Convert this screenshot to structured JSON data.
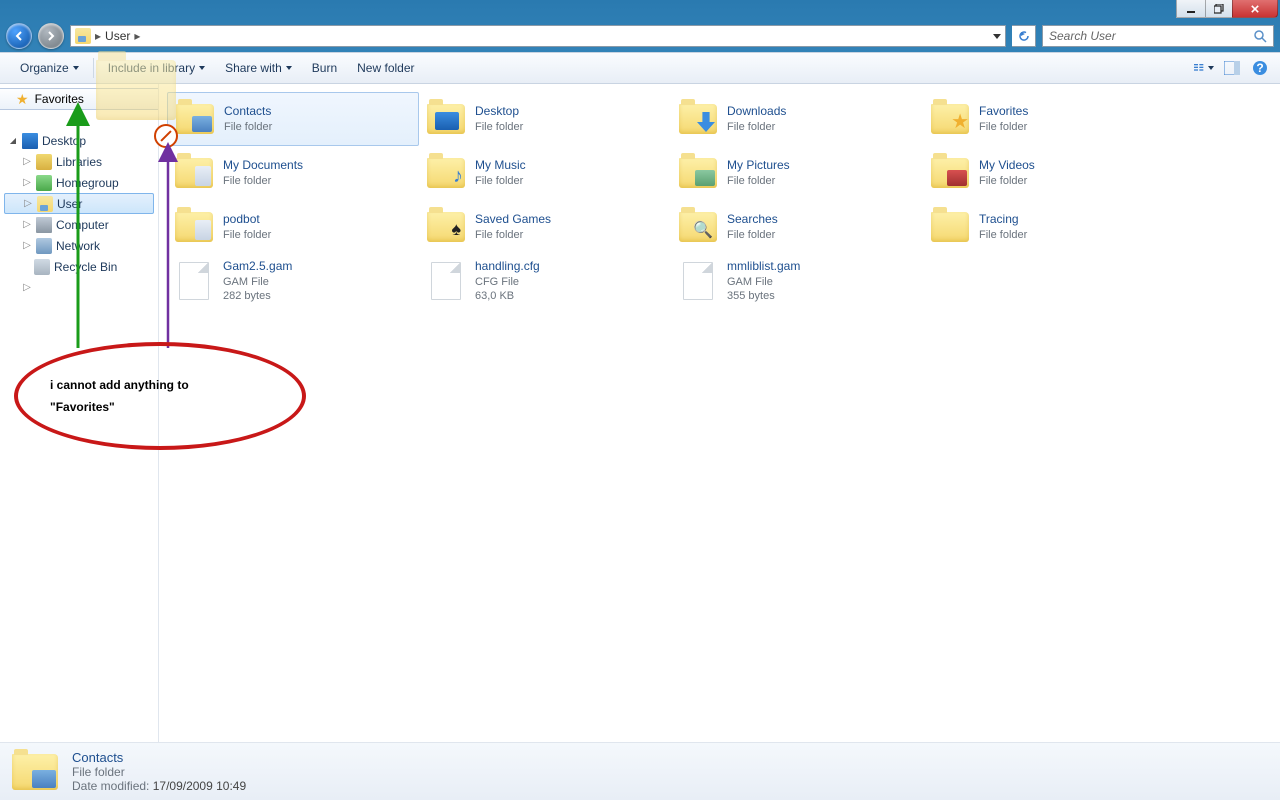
{
  "titlebar": {},
  "nav": {
    "path_item": "User",
    "search_placeholder": "Search User"
  },
  "toolbar": {
    "organize": "Organize",
    "include": "Include in library",
    "share": "Share with",
    "burn": "Burn",
    "newfolder": "New folder"
  },
  "sidebar": {
    "favorites": "Favorites",
    "tree": {
      "desktop": "Desktop",
      "libraries": "Libraries",
      "homegroup": "Homegroup",
      "user": "User",
      "computer": "Computer",
      "network": "Network",
      "recycle": "Recycle Bin"
    }
  },
  "items": {
    "contacts": {
      "name": "Contacts",
      "sub1": "File folder"
    },
    "desktop": {
      "name": "Desktop",
      "sub1": "File folder"
    },
    "downloads": {
      "name": "Downloads",
      "sub1": "File folder"
    },
    "favorites": {
      "name": "Favorites",
      "sub1": "File folder"
    },
    "mydocs": {
      "name": "My Documents",
      "sub1": "File folder"
    },
    "mymusic": {
      "name": "My Music",
      "sub1": "File folder"
    },
    "mypics": {
      "name": "My Pictures",
      "sub1": "File folder"
    },
    "myvids": {
      "name": "My Videos",
      "sub1": "File folder"
    },
    "podbot": {
      "name": "podbot",
      "sub1": "File folder"
    },
    "saved": {
      "name": "Saved Games",
      "sub1": "File folder"
    },
    "searches": {
      "name": "Searches",
      "sub1": "File folder"
    },
    "tracing": {
      "name": "Tracing",
      "sub1": "File folder"
    },
    "gam25": {
      "name": "Gam2.5.gam",
      "sub1": "GAM File",
      "sub2": "282 bytes"
    },
    "handling": {
      "name": "handling.cfg",
      "sub1": "CFG File",
      "sub2": "63,0 KB"
    },
    "mmlib": {
      "name": "mmliblist.gam",
      "sub1": "GAM File",
      "sub2": "355 bytes"
    }
  },
  "details": {
    "name": "Contacts",
    "type": "File folder",
    "modlabel": "Date modified:",
    "modval": "17/09/2009 10:49"
  },
  "annotation": {
    "line1": "i cannot add anything to",
    "line2": "\"Favorites\""
  }
}
